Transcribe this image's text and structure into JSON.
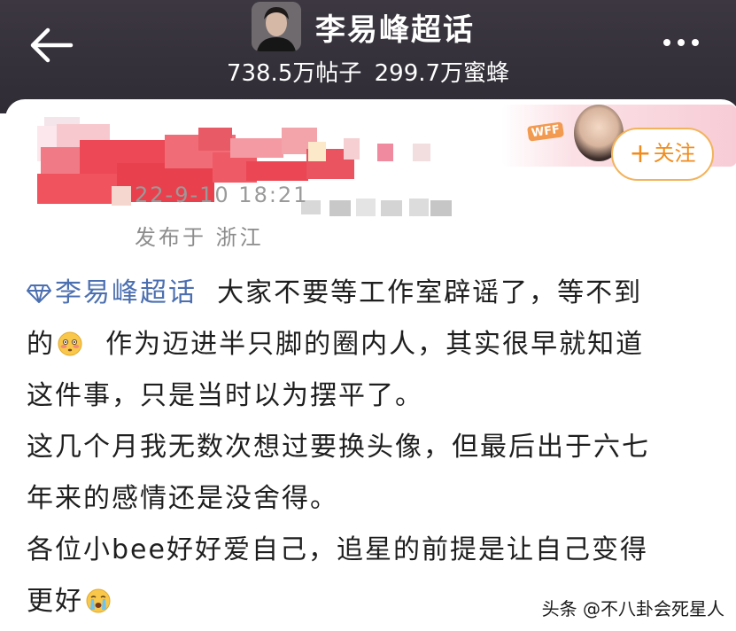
{
  "header": {
    "title": "李易峰超话",
    "posts_count": "738.5万帖子",
    "bees_count": "299.7万蜜蜂"
  },
  "post": {
    "timestamp": "22-9-10 18:21",
    "location": "发布于 浙江",
    "follow_label": "关注",
    "badge_text": "WFF",
    "topic_tag": "李易峰超话",
    "lines": [
      "大家不要等工作室辟谣了，等不到",
      "作为迈进半只脚的圈内人，其实很早就知道",
      "这件事，只是当时以为摆平了。",
      "这几个月我无数次想过要换头像，但最后出于六七",
      "年来的感情还是没舍得。",
      "各位小bee好好爱自己，追星的前提是让自己变得",
      "更好"
    ],
    "line1_suffix": "的"
  },
  "watermark": "头条 @不八卦会死星人",
  "colors": {
    "header_bg": "#38343e",
    "link": "#4c6fb0",
    "follow_accent": "#f08c1e",
    "redaction": "#e8474f"
  },
  "icons": [
    "back-arrow-icon",
    "more-dots-icon",
    "diamond-icon",
    "flushed-emoji-icon",
    "crying-emoji-icon",
    "plus-icon"
  ]
}
